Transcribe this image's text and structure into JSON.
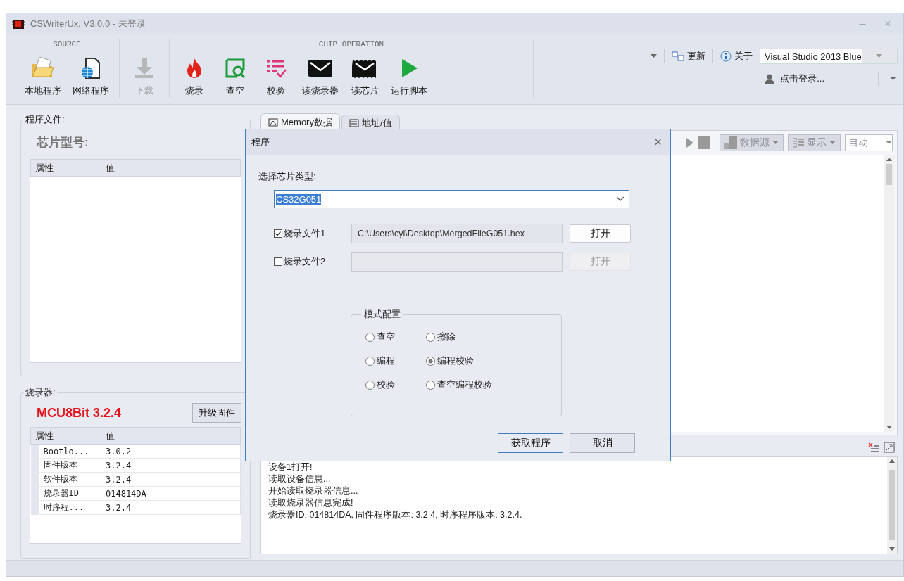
{
  "window": {
    "title": "CSWriterUx, V3.0.0 - 未登录",
    "minimize": "–",
    "close": "×"
  },
  "ribbon": {
    "groups": [
      {
        "label": "SOURCE",
        "buttons": [
          {
            "label": "本地程序",
            "disabled": false
          },
          {
            "label": "网络程序",
            "disabled": false
          }
        ]
      },
      {
        "buttons": [
          {
            "label": "下载",
            "disabled": true
          }
        ]
      },
      {
        "label": "CHIP OPERATION",
        "buttons": [
          {
            "label": "烧录",
            "disabled": false
          },
          {
            "label": "查空",
            "disabled": false
          },
          {
            "label": "校验",
            "disabled": false
          },
          {
            "label": "读烧录器",
            "disabled": false
          },
          {
            "label": "读芯片",
            "disabled": false
          },
          {
            "label": "运行脚本",
            "disabled": false
          }
        ]
      }
    ]
  },
  "quick_access": {
    "update": "更新",
    "about": "关于",
    "theme": "Visual Studio 2013 Blue",
    "login": "点击登录..."
  },
  "program_file": {
    "title": "程序文件:",
    "chip_model": "芯片型号:",
    "columns": [
      "属性",
      "值"
    ]
  },
  "programmer": {
    "title": "烧录器:",
    "model": "MCU8Bit 3.2.4",
    "upgrade_button": "升级固件",
    "columns": [
      "属性",
      "值"
    ],
    "rows": [
      {
        "property": "Bootlo...",
        "value": "3.0.2"
      },
      {
        "property": "固件版本",
        "value": "3.2.4"
      },
      {
        "property": "软件版本",
        "value": "3.2.4"
      },
      {
        "property": "烧录器ID",
        "value": "014814DA"
      },
      {
        "property": "时序程...",
        "value": "3.2.4"
      }
    ]
  },
  "tabs": [
    {
      "label": "Memory数据",
      "selected": true
    },
    {
      "label": "地址/值",
      "selected": false
    }
  ],
  "data_toolbar": {
    "data_source": "数据源",
    "display": "显示",
    "mode": "自动"
  },
  "log": {
    "lines": [
      "设备1打开!",
      "读取设备信息...",
      "开始读取烧录器信息...",
      "读取烧录器信息完成!",
      "烧录器ID: 014814DA, 固件程序版本: 3.2.4, 时序程序版本: 3.2.4."
    ]
  },
  "dialog": {
    "title": "程序",
    "close": "×",
    "chip_type_label": "选择芯片类型:",
    "chip_type": "CS32G051",
    "files": [
      {
        "label": "烧录文件1",
        "checked": true,
        "path": "C:\\Users\\cyl\\Desktop\\MergedFileG051.hex",
        "button": "打开",
        "disabled": false
      },
      {
        "label": "烧录文件2",
        "checked": false,
        "button": "打开",
        "disabled": true
      }
    ],
    "mode_group": {
      "title": "模式配置",
      "options": [
        {
          "label": "查空",
          "selected": false
        },
        {
          "label": "擦除",
          "selected": false
        },
        {
          "label": "编程",
          "selected": false
        },
        {
          "label": "编程校验",
          "selected": true
        },
        {
          "label": "校验",
          "selected": false
        },
        {
          "label": "查空编程校验",
          "selected": false
        }
      ]
    },
    "buttons": [
      {
        "label": "获取程序",
        "kind": "primary"
      },
      {
        "label": "取消",
        "kind": "secondary"
      }
    ]
  }
}
